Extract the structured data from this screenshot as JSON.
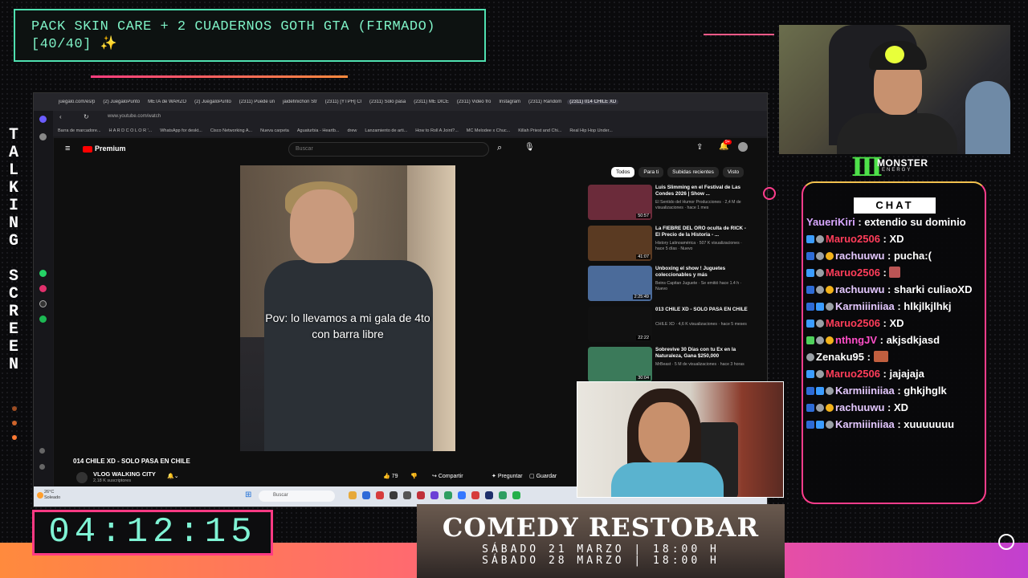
{
  "goal": {
    "line1": "PACK SKIN CARE + 2 CUADERNOS GOTH GTA (FIRMADO)",
    "line2": "[40/40] ✨"
  },
  "side_title": "T\nA\nL\nK\nI\nN\nG\n \nS\nC\nR\nE\nE\nN",
  "browser": {
    "tabs": [
      "juegalo.com/es/p",
      "(2) JuegaloPunto",
      "META de WARZO",
      "(2) JuegaloPunto",
      "(2311) Puede un",
      "jaidefinichon Str",
      "(2311) [YTPH] Cl",
      "(2311) Solo pasa",
      "(2311) ME DICE",
      "(2311) Video fro",
      "Instagram",
      "(2311) Random",
      "(2311) 014 CHILE XD"
    ],
    "url": "www.youtube.com/watch",
    "bookmarks": [
      "Barra de marcadore...",
      "H A R D C O L O R '...",
      "WhatsApp for deskt...",
      "Cisco Networking A...",
      "Nueva carpeta",
      "Aguaturbia - Heartb...",
      "drew",
      "Lanzamiento de arti...",
      "How to Roll A Joint?...",
      "MC Melodee x Chuc...",
      "Killah Priest and Chi...",
      "Real Hip Hop Under..."
    ]
  },
  "youtube": {
    "logo": "Premium",
    "search_placeholder": "Buscar",
    "notif_count": "9+",
    "caption": "Pov: lo llevamos a mi gala de 4to con barra libre",
    "video_title": "014 CHILE XD - SOLO PASA EN CHILE",
    "channel": "VLOG WALKING CITY",
    "subscribers": "2,18 K suscriptores",
    "likes": "79",
    "share": "Compartir",
    "ask": "Preguntar",
    "save": "Guardar",
    "chips": [
      "Todos",
      "Para ti",
      "Subidas recientes",
      "Visto"
    ],
    "recommendations": [
      {
        "title": "Luis Slimming en el Festival de Las Condes 2026 | Show ...",
        "meta": "El Sentido del Humor Producciones · 2,4 M de visualizaciones · hace 1 mes",
        "duration": "50:57",
        "color": "#6b2b3a"
      },
      {
        "title": "La FIEBRE DEL ORO oculta de RICK - El Precio de la Historia - ...",
        "meta": "History Latinoamérica · 507 K visualizaciones · hace 5 días · Nuevo",
        "duration": "41:07",
        "color": "#5a3a22"
      },
      {
        "title": "Unboxing el show ! Juguetes coleccionables y más",
        "meta": "Beins Capitan Juguete · Se emitió hace 1.4 h · Nuevo",
        "duration": "2:25:49",
        "color": "#4b6b9a"
      },
      {
        "title": "013 CHILE XD - SOLO PASA EN CHILE",
        "meta": "CHILE XD · 4,6 K visualizaciones · hace 5 meses",
        "duration": "22:22",
        "color": "#111111"
      },
      {
        "title": "Sobrevive 30 Días con tu Ex en la Naturaleza, Gana $250,000",
        "meta": "MrBeast · 5 M de visualizaciones · hace 3 horas",
        "duration": "30:04",
        "color": "#3b7a5a"
      }
    ]
  },
  "taskbar": {
    "temp": "26°C",
    "weather": "Soleado",
    "search": "Buscar"
  },
  "brand": {
    "name": "MONSTER",
    "sub": "ENERGY"
  },
  "chat": {
    "label": "CHAT",
    "messages": [
      {
        "user": "YaueriKiri",
        "text": "extendio su dominio",
        "color": "#d8a7ff",
        "badges": []
      },
      {
        "user": "Maruo2506",
        "text": "XD",
        "color": "#ff3d5a",
        "badges": [
          "blue",
          "gray"
        ]
      },
      {
        "user": "rachuuwu",
        "text": "pucha:(",
        "color": "#e4c8ff",
        "badges": [
          "sword",
          "gray",
          "gold"
        ]
      },
      {
        "user": "Maruo2506",
        "text": "",
        "color": "#ff3d5a",
        "badges": [
          "blue",
          "gray"
        ],
        "emote": true
      },
      {
        "user": "rachuuwu",
        "text": "sharki culiaoXD",
        "color": "#e4c8ff",
        "badges": [
          "sword",
          "gray",
          "gold"
        ],
        "wrap": true
      },
      {
        "user": "Karmiiiniiaa",
        "text": "hlkjlkjlhkj",
        "color": "#e4c8ff",
        "badges": [
          "sword",
          "blue",
          "gray"
        ]
      },
      {
        "user": "Maruo2506",
        "text": "XD",
        "color": "#ff3d5a",
        "badges": [
          "blue",
          "gray"
        ]
      },
      {
        "user": "nthngJV",
        "text": "akjsdkjasd",
        "color": "#ff4fc8",
        "badges": [
          "green",
          "gray",
          "gold"
        ]
      },
      {
        "user": "Zenaku95",
        "text": "",
        "color": "#ffffff",
        "badges": [
          "gray"
        ],
        "emote": true
      },
      {
        "user": "Maruo2506",
        "text": "jajajaja",
        "color": "#ff3d5a",
        "badges": [
          "blue",
          "gray"
        ]
      },
      {
        "user": "Karmiiiniiaa",
        "text": "ghkjhglk",
        "color": "#e4c8ff",
        "badges": [
          "sword",
          "blue",
          "gray"
        ]
      },
      {
        "user": "rachuuwu",
        "text": "XD",
        "color": "#e4c8ff",
        "badges": [
          "sword",
          "gray",
          "gold"
        ]
      },
      {
        "user": "Karmiiiniiaa",
        "text": "xuuuuuuu",
        "color": "#e4c8ff",
        "badges": [
          "sword",
          "blue",
          "gray"
        ]
      }
    ]
  },
  "timer": "04:12:15",
  "banner": {
    "title": "COMEDY RESTOBAR",
    "date1": "SÁBADO 21 MARZO | 18:00 H",
    "date2": "SÁBADO 28 MARZO | 18:00 H"
  }
}
